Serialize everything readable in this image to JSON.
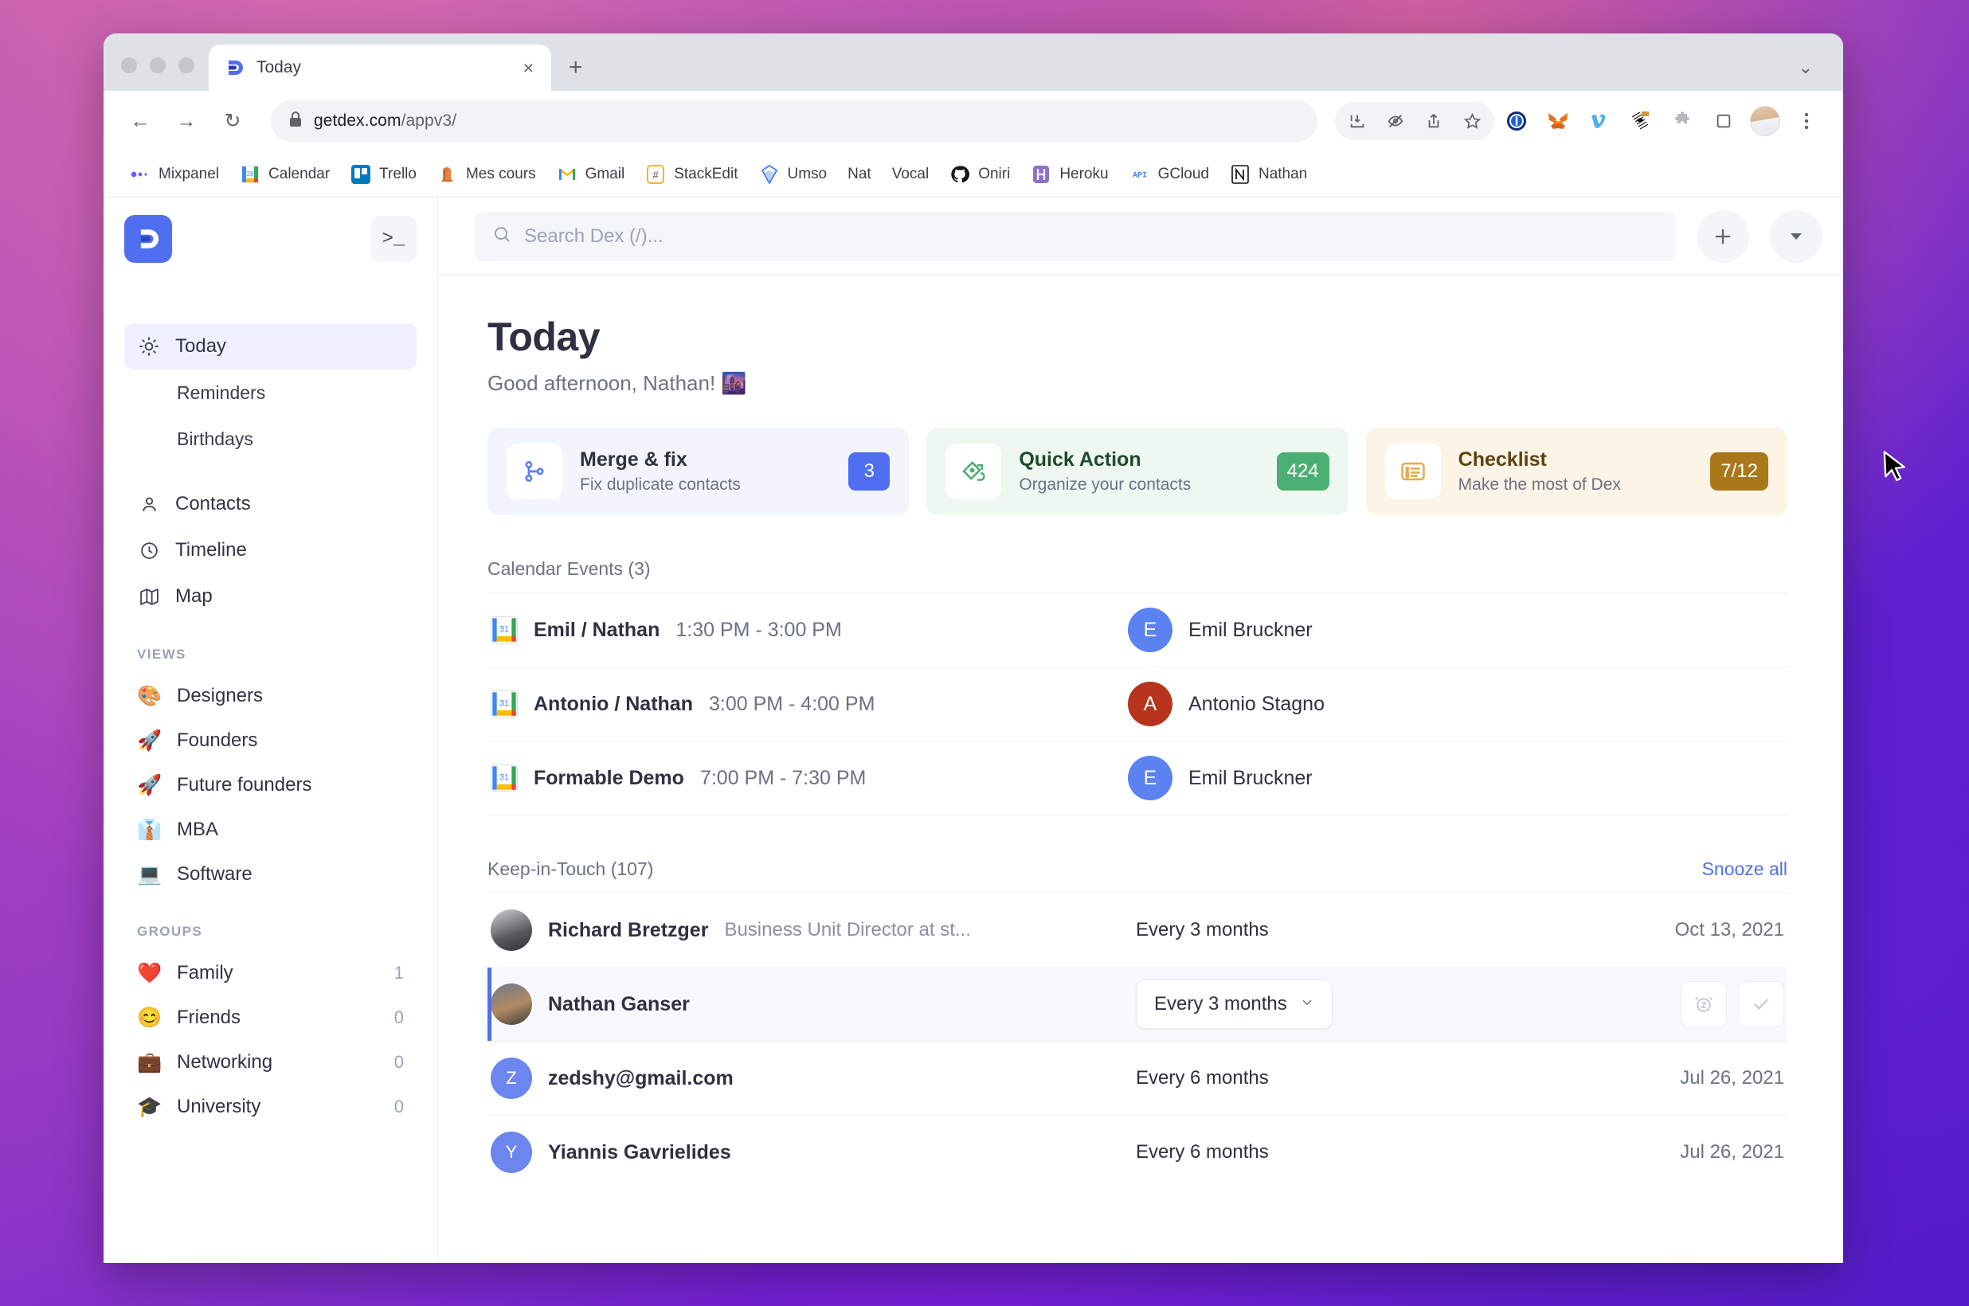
{
  "browser": {
    "tab": {
      "title": "Today",
      "favicon": "dex-logo-icon",
      "close_label": "×"
    },
    "new_tab_label": "+",
    "tabstrip_chevron": "⌄",
    "nav": {
      "back": "←",
      "forward": "→",
      "reload": "↻"
    },
    "omnibox": {
      "lock": "lock-icon",
      "domain": "getdex.com",
      "path": "/appv3/"
    },
    "toolbar_icons": [
      {
        "name": "install-app-icon",
        "glyph": "⤓"
      },
      {
        "name": "hide-password-icon",
        "glyph": "⊘"
      },
      {
        "name": "share-icon",
        "glyph": "⇧"
      },
      {
        "name": "bookmark-star-icon",
        "glyph": "☆"
      },
      {
        "name": "1password-extension-icon",
        "glyph": "Ⓘ"
      },
      {
        "name": "metamask-extension-icon",
        "glyph": "🦊"
      },
      {
        "name": "vimeo-extension-icon",
        "glyph": "v"
      },
      {
        "name": "scribd-extension-icon",
        "glyph": "◈"
      },
      {
        "name": "extensions-puzzle-icon",
        "glyph": "🧩"
      },
      {
        "name": "side-panel-icon",
        "glyph": "▭"
      },
      {
        "name": "profile-avatar",
        "glyph": ""
      },
      {
        "name": "chrome-menu-icon",
        "glyph": "⋮"
      }
    ],
    "bookmarks": [
      {
        "label": "Mixpanel",
        "icon": "mixpanel-icon"
      },
      {
        "label": "Calendar",
        "icon": "google-calendar-icon"
      },
      {
        "label": "Trello",
        "icon": "trello-icon"
      },
      {
        "label": "Mes cours",
        "icon": "mes-cours-icon"
      },
      {
        "label": "Gmail",
        "icon": "gmail-icon"
      },
      {
        "label": "StackEdit",
        "icon": "stackedit-icon"
      },
      {
        "label": "Umso",
        "icon": "umso-icon"
      },
      {
        "label": "Nat",
        "icon": ""
      },
      {
        "label": "Vocal",
        "icon": ""
      },
      {
        "label": "Oniri",
        "icon": "github-icon"
      },
      {
        "label": "Heroku",
        "icon": "heroku-icon"
      },
      {
        "label": "GCloud",
        "icon": "api-icon"
      },
      {
        "label": "Nathan",
        "icon": "notion-icon"
      }
    ]
  },
  "sidebar": {
    "brand": "dex-logo-icon",
    "terminal_button": ">_",
    "nav": [
      {
        "label": "Today",
        "icon": "sun-icon",
        "active": true,
        "sub": false
      },
      {
        "label": "Reminders",
        "icon": "",
        "active": false,
        "sub": true
      },
      {
        "label": "Birthdays",
        "icon": "",
        "active": false,
        "sub": true
      },
      {
        "label": "Contacts",
        "icon": "person-icon",
        "active": false,
        "sub": false
      },
      {
        "label": "Timeline",
        "icon": "clock-icon",
        "active": false,
        "sub": false
      },
      {
        "label": "Map",
        "icon": "map-icon",
        "active": false,
        "sub": false
      }
    ],
    "views_header": "VIEWS",
    "views": [
      {
        "label": "Designers",
        "emoji": "🎨"
      },
      {
        "label": "Founders",
        "emoji": "🚀"
      },
      {
        "label": "Future founders",
        "emoji": "🚀"
      },
      {
        "label": "MBA",
        "emoji": "👔"
      },
      {
        "label": "Software",
        "emoji": "💻"
      }
    ],
    "groups_header": "GROUPS",
    "groups": [
      {
        "label": "Family",
        "emoji": "❤️",
        "count": "1"
      },
      {
        "label": "Friends",
        "emoji": "😊",
        "count": "0"
      },
      {
        "label": "Networking",
        "emoji": "💼",
        "count": "0"
      },
      {
        "label": "University",
        "emoji": "🎓",
        "count": "0"
      }
    ]
  },
  "topbar": {
    "search_placeholder": "Search Dex (/)...",
    "search_value": "",
    "add_button": "+",
    "dropdown_button": "▼"
  },
  "page": {
    "title": "Today",
    "greeting": "Good afternoon, Nathan! 🌆"
  },
  "cards": [
    {
      "title": "Merge & fix",
      "subtitle": "Fix duplicate contacts",
      "badge": "3",
      "tone": "blue",
      "icon": "merge-icon"
    },
    {
      "title": "Quick Action",
      "subtitle": "Organize your contacts",
      "badge": "424",
      "tone": "green",
      "icon": "tag-icon"
    },
    {
      "title": "Checklist",
      "subtitle": "Make the most of Dex",
      "badge": "7/12",
      "tone": "amber",
      "icon": "list-icon"
    }
  ],
  "calendar": {
    "section_title": "Calendar Events (3)",
    "events": [
      {
        "name": "Emil / Nathan",
        "time": "1:30 PM - 3:00 PM",
        "attendee": "Emil Bruckner",
        "initial": "E",
        "color": "#5b82f0"
      },
      {
        "name": "Antonio / Nathan",
        "time": "3:00 PM - 4:00 PM",
        "attendee": "Antonio Stagno",
        "initial": "A",
        "color": "#b5341b"
      },
      {
        "name": "Formable Demo",
        "time": "7:00 PM - 7:30 PM",
        "attendee": "Emil Bruckner",
        "initial": "E",
        "color": "#5b82f0"
      }
    ]
  },
  "keep_in_touch": {
    "section_title": "Keep-in-Touch (107)",
    "snooze_all": "Snooze all",
    "rows": [
      {
        "name": "Richard Bretzger",
        "role": "Business Unit Director at st...",
        "frequency": "Every 3 months",
        "date": "Oct 13, 2021",
        "initial": "R",
        "color": "#8d8d93",
        "selected": false,
        "photo": true
      },
      {
        "name": "Nathan Ganser",
        "role": "",
        "frequency": "Every 3 months",
        "date": "",
        "initial": "N",
        "color": "#7a6a58",
        "selected": true,
        "photo": true,
        "snooze_icon": "alarm-snooze-icon",
        "done_icon": "check-icon",
        "chevron": "⌄"
      },
      {
        "name": "zedshy@gmail.com",
        "role": "",
        "frequency": "Every 6 months",
        "date": "Jul 26, 2021",
        "initial": "Z",
        "color": "#6b86ef",
        "selected": false,
        "photo": false
      },
      {
        "name": "Yiannis Gavrielides",
        "role": "",
        "frequency": "Every 6 months",
        "date": "Jul 26, 2021",
        "initial": "Y",
        "color": "#6b86ef",
        "selected": false,
        "photo": false
      }
    ]
  },
  "colors": {
    "accent": "#4f6ff0",
    "green": "#4caf72",
    "amber": "#a8781a",
    "text": "#2d3142",
    "muted": "#6b7285"
  }
}
